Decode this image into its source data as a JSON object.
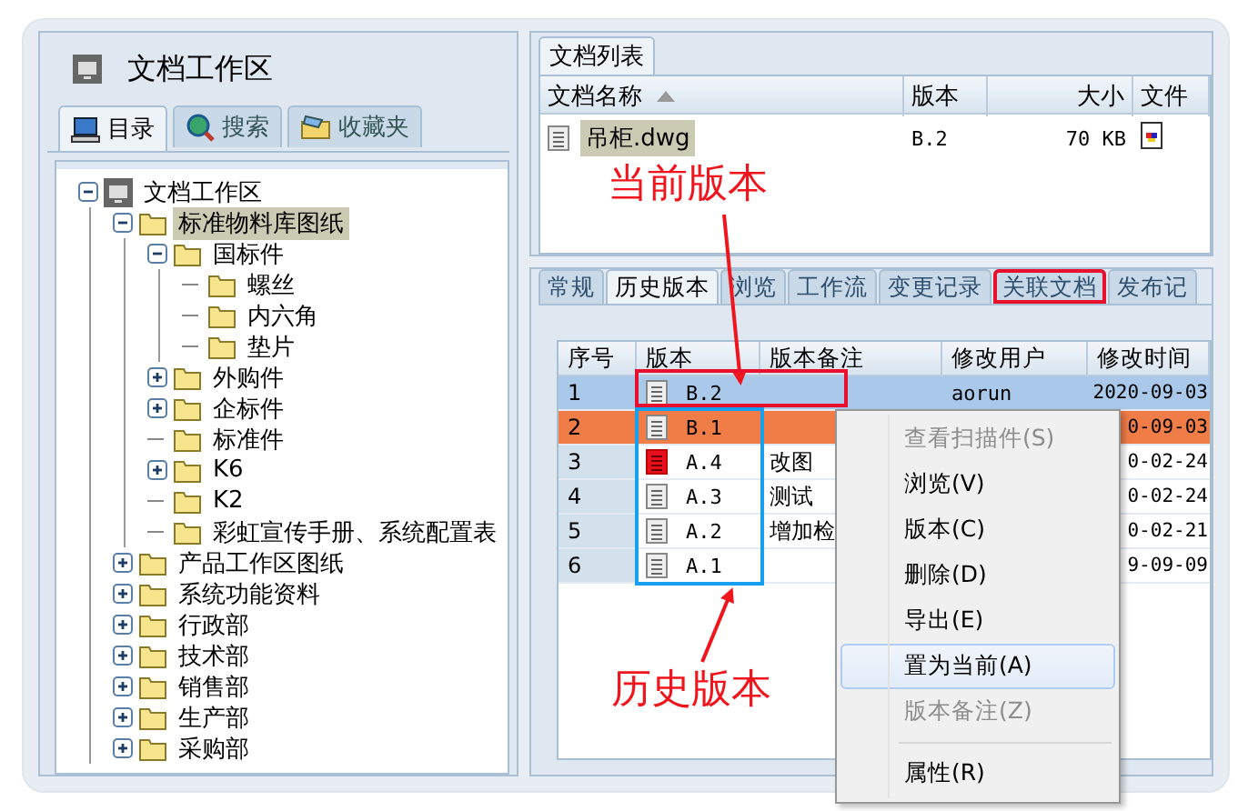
{
  "workspace": {
    "title": "文档工作区",
    "tabs": [
      {
        "label": "目录",
        "selected": true
      },
      {
        "label": "搜索",
        "selected": false
      },
      {
        "label": "收藏夹",
        "selected": false
      }
    ],
    "tree": [
      {
        "label": "文档工作区",
        "kind": "root",
        "selected": false,
        "expanded": true,
        "children": [
          {
            "label": "标准物料库图纸",
            "kind": "folder",
            "selected": true,
            "expanded": true,
            "children": [
              {
                "label": "国标件",
                "kind": "folder",
                "selected": false,
                "expanded": true,
                "children": [
                  {
                    "label": "螺丝",
                    "kind": "folder",
                    "selected": false
                  },
                  {
                    "label": "内六角",
                    "kind": "folder",
                    "selected": false
                  },
                  {
                    "label": "垫片",
                    "kind": "folder",
                    "selected": false
                  }
                ]
              },
              {
                "label": "外购件",
                "kind": "folder",
                "selected": false,
                "expanded": false
              },
              {
                "label": "企标件",
                "kind": "folder",
                "selected": false,
                "expanded": false
              },
              {
                "label": "标准件",
                "kind": "folder",
                "selected": false
              },
              {
                "label": "K6",
                "kind": "folder",
                "selected": false,
                "expanded": false
              },
              {
                "label": "K2",
                "kind": "folder",
                "selected": false
              },
              {
                "label": "彩虹宣传手册、系统配置表",
                "kind": "folder",
                "selected": false
              }
            ]
          },
          {
            "label": "产品工作区图纸",
            "kind": "folder",
            "selected": false,
            "expanded": false
          },
          {
            "label": "系统功能资料",
            "kind": "folder",
            "selected": false,
            "expanded": false
          },
          {
            "label": "行政部",
            "kind": "folder",
            "selected": false,
            "expanded": false
          },
          {
            "label": "技术部",
            "kind": "folder",
            "selected": false,
            "expanded": false
          },
          {
            "label": "销售部",
            "kind": "folder",
            "selected": false,
            "expanded": false
          },
          {
            "label": "生产部",
            "kind": "folder",
            "selected": false,
            "expanded": false
          },
          {
            "label": "采购部",
            "kind": "folder",
            "selected": false,
            "expanded": false
          }
        ]
      }
    ]
  },
  "document_list": {
    "tab": "文档列表",
    "columns": [
      "文档名称",
      "版本",
      "大小",
      "文件"
    ],
    "rows": [
      {
        "name": "吊柜.dwg",
        "version": "B.2",
        "size": "70 KB",
        "selected": true
      }
    ]
  },
  "detail_tabs": [
    {
      "label": "常规",
      "selected": false,
      "highlighted": false
    },
    {
      "label": "历史版本",
      "selected": true,
      "highlighted": false
    },
    {
      "label": "浏览",
      "selected": false,
      "highlighted": false
    },
    {
      "label": "工作流",
      "selected": false,
      "highlighted": false
    },
    {
      "label": "变更记录",
      "selected": false,
      "highlighted": false
    },
    {
      "label": "关联文档",
      "selected": false,
      "highlighted": true
    },
    {
      "label": "发布记",
      "selected": false,
      "highlighted": false
    }
  ],
  "history": {
    "columns": [
      "序号",
      "版本",
      "版本备注",
      "修改用户",
      "修改时间"
    ],
    "rows": [
      {
        "no": "1",
        "version": "B.2",
        "kind": "normal",
        "user": "aorun",
        "time": "2020-09-03",
        "selected": true,
        "context_target": false
      },
      {
        "no": "2",
        "version": "B.1",
        "kind": "normal",
        "time": "0-09-03",
        "selected": false,
        "context_target": true
      },
      {
        "no": "3",
        "version": "A.4",
        "kind": "marked",
        "note": "改图",
        "time": "0-02-24",
        "selected": false,
        "context_target": false
      },
      {
        "no": "4",
        "version": "A.3",
        "kind": "normal",
        "note": "测试",
        "time": "0-02-24",
        "selected": false,
        "context_target": false
      },
      {
        "no": "5",
        "version": "A.2",
        "kind": "normal",
        "note": "增加检",
        "time": "0-02-21",
        "selected": false,
        "context_target": false
      },
      {
        "no": "6",
        "version": "A.1",
        "kind": "normal",
        "time": "9-09-09",
        "selected": false,
        "context_target": false
      }
    ]
  },
  "context_menu": [
    {
      "kind": "item",
      "label": "查看扫描件(S)",
      "disabled": true,
      "highlighted": false
    },
    {
      "kind": "item",
      "label": "浏览(V)",
      "disabled": false,
      "highlighted": false
    },
    {
      "kind": "item",
      "label": "版本(C)",
      "disabled": false,
      "highlighted": false
    },
    {
      "kind": "item",
      "label": "删除(D)",
      "disabled": false,
      "highlighted": false
    },
    {
      "kind": "item",
      "label": "导出(E)",
      "disabled": false,
      "highlighted": false
    },
    {
      "kind": "item",
      "label": "置为当前(A)",
      "disabled": false,
      "highlighted": true
    },
    {
      "kind": "item",
      "label": "版本备注(Z)",
      "disabled": true,
      "highlighted": false
    },
    {
      "kind": "separator"
    },
    {
      "kind": "item",
      "label": "属性(R)",
      "disabled": false,
      "highlighted": false
    }
  ],
  "annotations": [
    {
      "kind": "current",
      "text": "当前版本"
    },
    {
      "kind": "history",
      "text": "历史版本"
    }
  ]
}
